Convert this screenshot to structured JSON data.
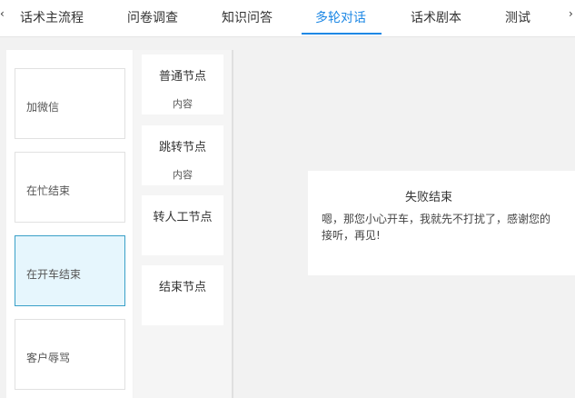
{
  "tabs": [
    {
      "label": "话术主流程",
      "active": false
    },
    {
      "label": "问卷调查",
      "active": false
    },
    {
      "label": "知识问答",
      "active": false
    },
    {
      "label": "多轮对话",
      "active": true
    },
    {
      "label": "话术剧本",
      "active": false
    },
    {
      "label": "测试",
      "active": false
    }
  ],
  "accent_color": "#1e88e5",
  "scenes": [
    {
      "label": "加微信",
      "selected": false
    },
    {
      "label": "在忙结束",
      "selected": false
    },
    {
      "label": "在开车结束",
      "selected": true
    },
    {
      "label": "客户辱骂",
      "selected": false
    }
  ],
  "node_palette": [
    {
      "title": "普通节点",
      "subtitle": "内容"
    },
    {
      "title": "跳转节点",
      "subtitle": "内容"
    },
    {
      "title": "转人工节点",
      "subtitle": ""
    },
    {
      "title": "结束节点",
      "subtitle": ""
    }
  ],
  "canvas": {
    "end_node": {
      "title": "失败结束",
      "text": "嗯，那您小心开车，我就先不打扰了，感谢您的接听，再见!"
    }
  }
}
